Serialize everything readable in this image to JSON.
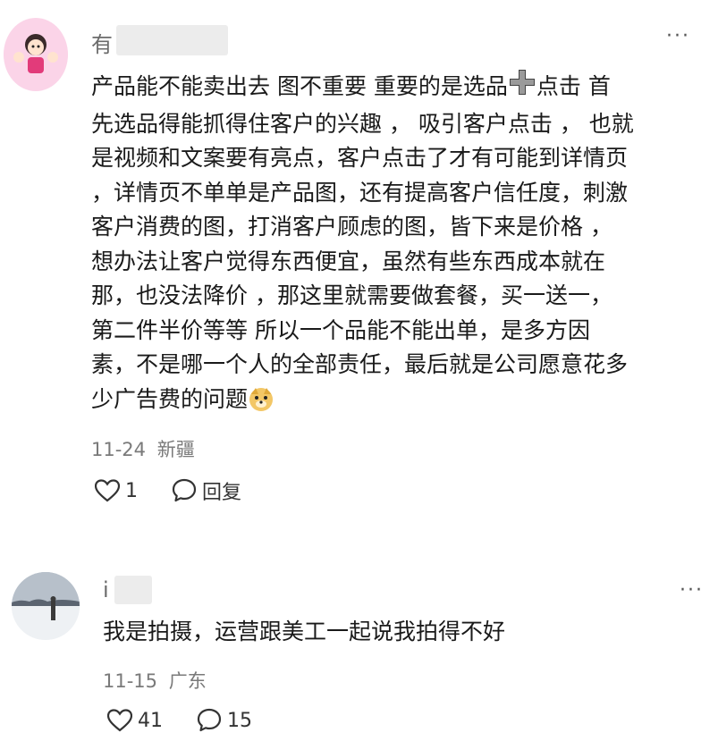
{
  "comments": [
    {
      "username": "有",
      "text_lines": [
        "产品能不能卖出去 图不重要 重要的是选品",
        "先选品得能抓得住客户的兴趣 ， 吸引客户点击 ， 也就",
        "是视频和文案要有亮点，客户点击了才有可能到详情页",
        "，详情页不单单是产品图，还有提高客户信任度，刺激",
        "客户消费的图，打消客户顾虑的图，皆下来是价格 ，",
        "想办法让客户觉得东西便宜，虽然有些东西成本就在",
        "那，也没法降价 ，那这里就需要做套餐，买一送一，",
        "第二件半价等等 所以一个品能不能出单，是多方因",
        "素，不是哪一个人的全部责任，最后就是公司愿意花多",
        "少广告费的问题"
      ],
      "line1_suffix": "点击 首",
      "date": "11-24",
      "location": "新疆",
      "likes": "1",
      "reply_label": "回复"
    },
    {
      "username": "i",
      "text_lines": [
        "我是拍摄，运营跟美工一起说我拍得不好"
      ],
      "date": "11-15",
      "location": "广东",
      "likes": "41",
      "replies": "15"
    }
  ],
  "icons": {
    "more": "more-dots-icon",
    "like": "heart-outline-icon",
    "reply": "speech-bubble-icon",
    "plus": "plus-icon",
    "emoji": "doge-emoji-icon"
  },
  "more_glyph": "···"
}
